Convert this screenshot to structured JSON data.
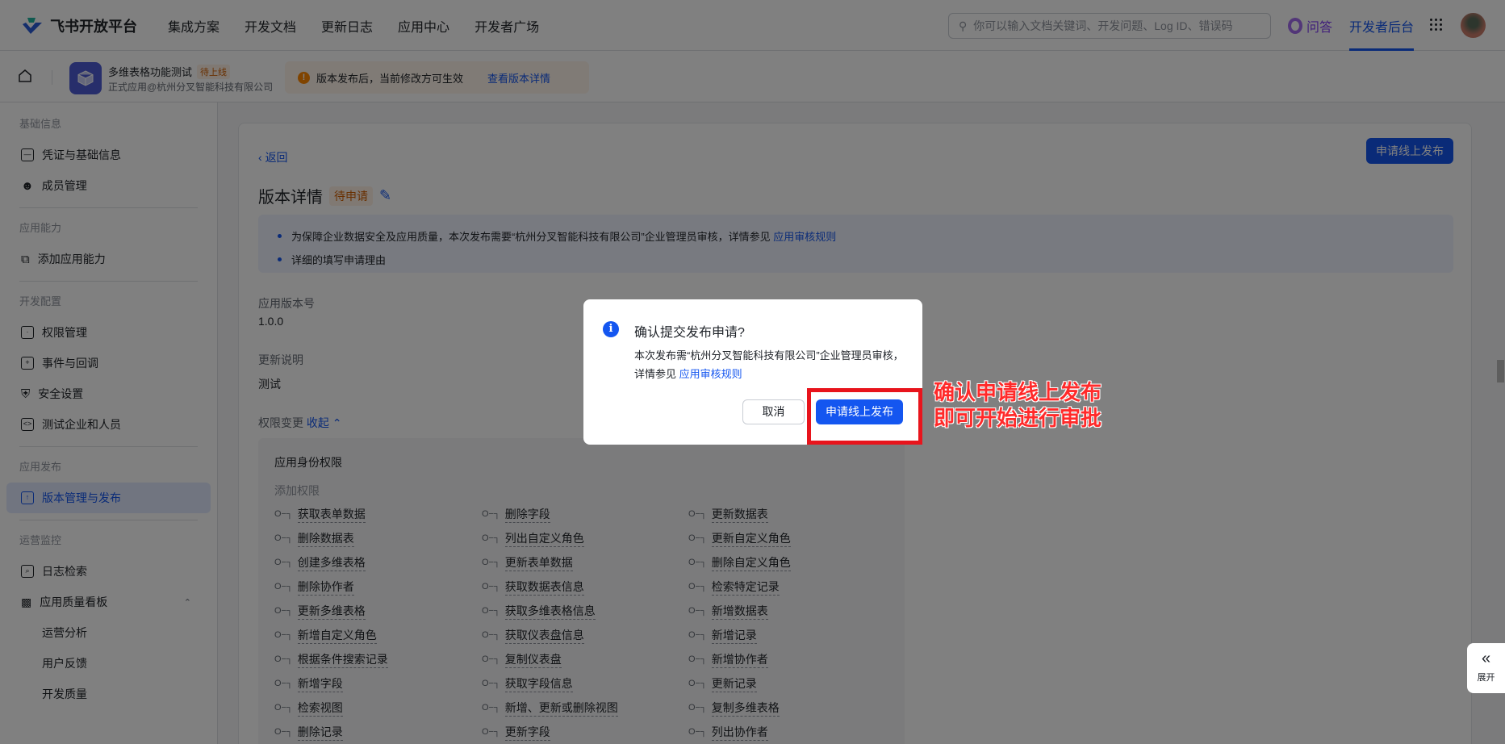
{
  "header": {
    "brand": "飞书开放平台",
    "nav": [
      "集成方案",
      "开发文档",
      "更新日志",
      "应用中心",
      "开发者广场"
    ],
    "search_placeholder": "你可以输入文档关键词、开发问题、Log ID、错误码",
    "qa": "问答",
    "dev_console": "开发者后台"
  },
  "app": {
    "name": "多维表格功能测试",
    "status": "待上线",
    "subtitle": "正式应用@杭州分叉智能科技有限公司",
    "notice": "版本发布后，当前修改方可生效",
    "notice_link": "查看版本详情"
  },
  "sidebar": {
    "groups": [
      {
        "title": "基础信息",
        "items": [
          "凭证与基础信息",
          "成员管理"
        ]
      },
      {
        "title": "应用能力",
        "items": [
          "添加应用能力"
        ]
      },
      {
        "title": "开发配置",
        "items": [
          "权限管理",
          "事件与回调",
          "安全设置",
          "测试企业和人员"
        ]
      },
      {
        "title": "应用发布",
        "items": [
          "版本管理与发布"
        ]
      },
      {
        "title": "运营监控",
        "items": [
          "日志检索",
          "应用质量看板"
        ],
        "subitems": [
          "运营分析",
          "用户反馈",
          "开发质量"
        ]
      }
    ]
  },
  "main": {
    "back": "返回",
    "publish_button": "申请线上发布",
    "title": "版本详情",
    "status": "待申请",
    "info": [
      "为保障企业数据安全及应用质量，本次发布需要“杭州分叉智能科技有限公司”企业管理员审核，详情参见 ",
      "详细的填写申请理由"
    ],
    "info_link": "应用审核规则",
    "version_label": "应用版本号",
    "version": "1.0.0",
    "notes_label": "更新说明",
    "notes": "测试",
    "perm_change_label": "权限变更",
    "collapse": "收起",
    "perm_title": "应用身份权限",
    "perm_added": "添加权限",
    "permissions": [
      "获取表单数据",
      "删除字段",
      "更新数据表",
      "删除数据表",
      "列出自定义角色",
      "更新自定义角色",
      "创建多维表格",
      "更新表单数据",
      "删除自定义角色",
      "删除协作者",
      "获取数据表信息",
      "检索特定记录",
      "更新多维表格",
      "获取多维表格信息",
      "新增数据表",
      "新增自定义角色",
      "获取仪表盘信息",
      "新增记录",
      "根据条件搜索记录",
      "复制仪表盘",
      "新增协作者",
      "新增字段",
      "获取字段信息",
      "更新记录",
      "检索视图",
      "新增、更新或删除视图",
      "复制多维表格",
      "删除记录",
      "更新字段",
      "列出协作者"
    ]
  },
  "modal": {
    "title": "确认提交发布申请?",
    "desc": "本次发布需“杭州分叉智能科技有限公司”企业管理员审核，详情参见 ",
    "link": "应用审核规则",
    "cancel": "取消",
    "confirm": "申请线上发布"
  },
  "annotation": {
    "line1": "确认申请线上发布",
    "line2": "即可开始进行审批"
  },
  "expand": "展开"
}
